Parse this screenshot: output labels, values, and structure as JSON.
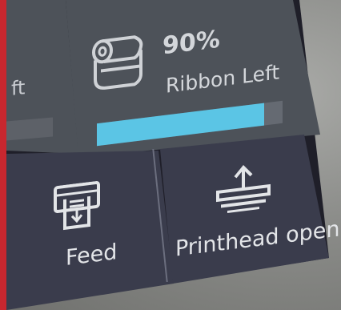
{
  "ribbon": {
    "percent_text": "90%",
    "label": "Ribbon Left",
    "progress_fraction": 0.9,
    "fill_color": "#5bc5e5",
    "icon": "ribbon-roll-icon"
  },
  "left_tile": {
    "partial_text": "ft"
  },
  "actions": [
    {
      "label": "Feed",
      "icon": "feed-icon"
    },
    {
      "label": "Printhead open",
      "icon": "printhead-open-icon"
    }
  ],
  "colors": {
    "status_strip": "#c8272f",
    "top_tile": "#4d5259",
    "bottom_tile": "#3a3c4c"
  }
}
